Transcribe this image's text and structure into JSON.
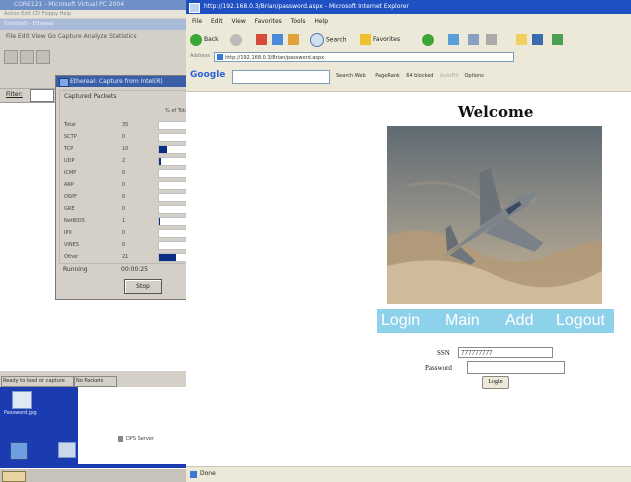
{
  "vpc": {
    "title": "CORE121 - Microsoft Virtual PC 2004",
    "menu": "Action  Edit  CD  Floppy  Help",
    "ethereal_title": "(Untitled) - Ethereal",
    "ethereal_menu": "File  Edit  View  Go  Capture  Analyze  Statistics",
    "filter_label": "Filter:"
  },
  "capture": {
    "title": "Ethereal: Capture from Intel(R)",
    "group_label": "Captured Packets",
    "pct_header": "% of Total",
    "rows": [
      {
        "name": "Total",
        "count": "35",
        "fraction": 0
      },
      {
        "name": "SCTP",
        "count": "0",
        "fraction": 0
      },
      {
        "name": "TCP",
        "count": "10",
        "fraction": 0.29
      },
      {
        "name": "UDP",
        "count": "2",
        "fraction": 0.06
      },
      {
        "name": "ICMP",
        "count": "0",
        "fraction": 0
      },
      {
        "name": "ARP",
        "count": "0",
        "fraction": 0
      },
      {
        "name": "OSPF",
        "count": "0",
        "fraction": 0
      },
      {
        "name": "GRE",
        "count": "0",
        "fraction": 0
      },
      {
        "name": "NetBIOS",
        "count": "1",
        "fraction": 0.03
      },
      {
        "name": "IPX",
        "count": "0",
        "fraction": 0
      },
      {
        "name": "VINES",
        "count": "0",
        "fraction": 0
      },
      {
        "name": "Other",
        "count": "21",
        "fraction": 0.6
      }
    ],
    "running_label": "Running",
    "running_time": "00:00:25",
    "stop_label": "Stop"
  },
  "eth_status": {
    "left": "Ready to load or capture",
    "right": "No Packets"
  },
  "desktop": {
    "icon_label": "Password.jpg",
    "dps_label": "DPS Server"
  },
  "ie": {
    "title": "http://192.168.0.3/Brian/password.aspx - Microsoft Internet Explorer",
    "menu": [
      "File",
      "Edit",
      "View",
      "Favorites",
      "Tools",
      "Help"
    ],
    "back_label": "Back",
    "search_label": "Search",
    "favorites_label": "Favorites",
    "address_label": "Address",
    "address_value": "http://192.168.0.3/Brian/password.aspx",
    "google_label": "Google",
    "google_search_label": "Search Web",
    "popups_label": "PageRank",
    "blocked_label": "64 blocked",
    "autofill_label": "AutoFill",
    "options_label": "Options",
    "status": "Done"
  },
  "page": {
    "welcome": "Welcome",
    "nav": [
      "Login",
      "Main",
      "Add",
      "Logout"
    ],
    "ssn_label": "SSN",
    "ssn_value": "777777777",
    "password_label": "Password",
    "login_button": "Login"
  },
  "colors": {
    "nav_bg": "#8ed1ea",
    "ie_title_bg": "#1e4fc3",
    "ethereal_bar": "#0a2e84"
  }
}
